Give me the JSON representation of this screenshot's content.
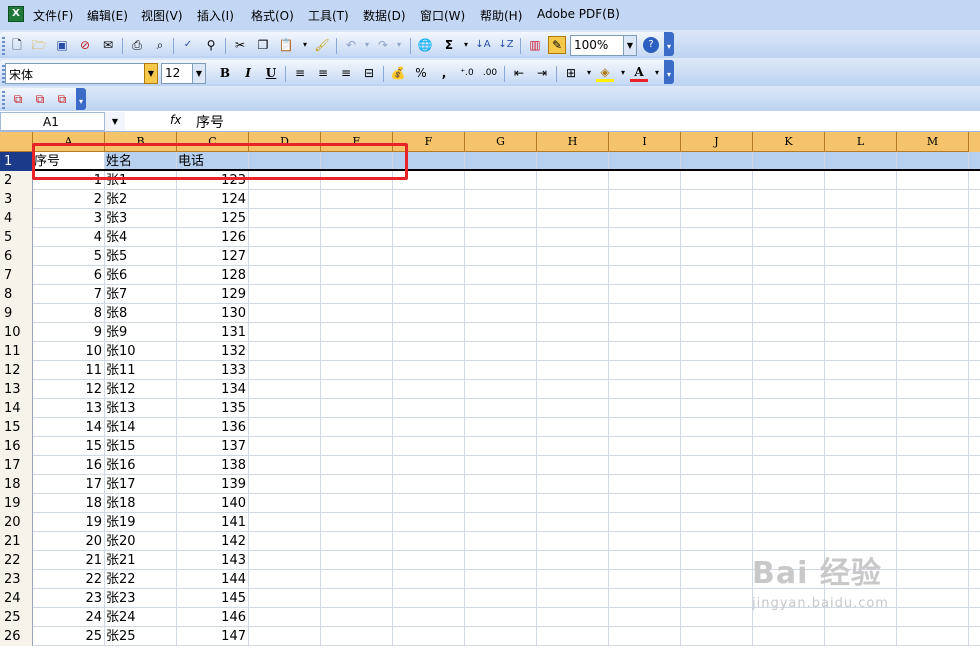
{
  "menubar": {
    "items": [
      "文件(F)",
      "编辑(E)",
      "视图(V)",
      "插入(I)",
      "格式(O)",
      "工具(T)",
      "数据(D)",
      "窗口(W)",
      "帮助(H)",
      "Adobe PDF(B)"
    ]
  },
  "toolbar": {
    "zoom": "100%",
    "font_name": "宋体",
    "font_size": "12",
    "bold": "B",
    "italic": "I",
    "underline": "U",
    "percent": "%",
    "comma": ",",
    "sum": "Σ",
    "font_color_letter": "A"
  },
  "formula_bar": {
    "name_box": "A1",
    "fx": "fx",
    "content": "序号"
  },
  "columns": [
    "A",
    "B",
    "C",
    "D",
    "E",
    "F",
    "G",
    "H",
    "I",
    "J",
    "K",
    "L",
    "M"
  ],
  "header_row": {
    "row": "1",
    "a": "序号",
    "b": "姓名",
    "c": "电话"
  },
  "rows": [
    {
      "row": "2",
      "a": "1",
      "b": "张1",
      "c": "123"
    },
    {
      "row": "3",
      "a": "2",
      "b": "张2",
      "c": "124"
    },
    {
      "row": "4",
      "a": "3",
      "b": "张3",
      "c": "125"
    },
    {
      "row": "5",
      "a": "4",
      "b": "张4",
      "c": "126"
    },
    {
      "row": "6",
      "a": "5",
      "b": "张5",
      "c": "127"
    },
    {
      "row": "7",
      "a": "6",
      "b": "张6",
      "c": "128"
    },
    {
      "row": "8",
      "a": "7",
      "b": "张7",
      "c": "129"
    },
    {
      "row": "9",
      "a": "8",
      "b": "张8",
      "c": "130"
    },
    {
      "row": "10",
      "a": "9",
      "b": "张9",
      "c": "131"
    },
    {
      "row": "11",
      "a": "10",
      "b": "张10",
      "c": "132"
    },
    {
      "row": "12",
      "a": "11",
      "b": "张11",
      "c": "133"
    },
    {
      "row": "13",
      "a": "12",
      "b": "张12",
      "c": "134"
    },
    {
      "row": "14",
      "a": "13",
      "b": "张13",
      "c": "135"
    },
    {
      "row": "15",
      "a": "14",
      "b": "张14",
      "c": "136"
    },
    {
      "row": "16",
      "a": "15",
      "b": "张15",
      "c": "137"
    },
    {
      "row": "17",
      "a": "16",
      "b": "张16",
      "c": "138"
    },
    {
      "row": "18",
      "a": "17",
      "b": "张17",
      "c": "139"
    },
    {
      "row": "19",
      "a": "18",
      "b": "张18",
      "c": "140"
    },
    {
      "row": "20",
      "a": "19",
      "b": "张19",
      "c": "141"
    },
    {
      "row": "21",
      "a": "20",
      "b": "张20",
      "c": "142"
    },
    {
      "row": "22",
      "a": "21",
      "b": "张21",
      "c": "143"
    },
    {
      "row": "23",
      "a": "22",
      "b": "张22",
      "c": "144"
    },
    {
      "row": "24",
      "a": "23",
      "b": "张23",
      "c": "145"
    },
    {
      "row": "25",
      "a": "24",
      "b": "张24",
      "c": "146"
    },
    {
      "row": "26",
      "a": "25",
      "b": "张25",
      "c": "147"
    }
  ],
  "watermark": {
    "line1": "Bai 经验",
    "line2": "jingyan.baidu.com"
  },
  "colors": {
    "accent": "#e8242a",
    "header": "#f5c36a",
    "toolbar": "#c3d7f5"
  }
}
